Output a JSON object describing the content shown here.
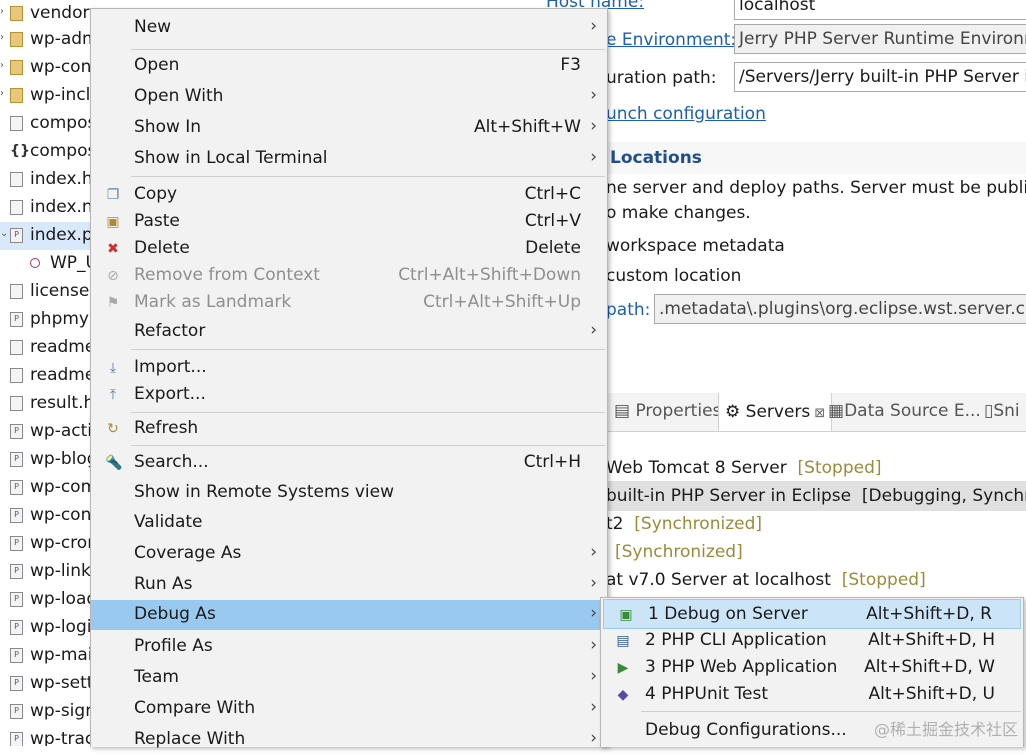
{
  "explorer": {
    "items": [
      {
        "name": "vendor",
        "icon": "folder-icon"
      },
      {
        "name": "wp-adm",
        "icon": "folder-icon"
      },
      {
        "name": "wp-con",
        "icon": "folder-icon"
      },
      {
        "name": "wp-inclu",
        "icon": "folder-icon"
      },
      {
        "name": "compos",
        "icon": "file-icon"
      },
      {
        "name": "compos",
        "icon": "json-file-icon"
      },
      {
        "name": "index.ht",
        "icon": "file-icon"
      },
      {
        "name": "index.ng",
        "icon": "file-icon"
      },
      {
        "name": "index.ph",
        "icon": "php-file-icon"
      },
      {
        "name": "WP_U",
        "icon": "class-icon"
      },
      {
        "name": "license.t",
        "icon": "file-icon"
      },
      {
        "name": "phpmya",
        "icon": "php-file-icon"
      },
      {
        "name": "readme",
        "icon": "file-icon"
      },
      {
        "name": "readme",
        "icon": "file-icon"
      },
      {
        "name": "result.ht",
        "icon": "file-icon"
      },
      {
        "name": "wp-acti",
        "icon": "php-file-icon"
      },
      {
        "name": "wp-blog",
        "icon": "php-file-icon"
      },
      {
        "name": "wp-com",
        "icon": "php-file-icon"
      },
      {
        "name": "wp-con",
        "icon": "php-file-icon"
      },
      {
        "name": "wp-cron",
        "icon": "php-file-icon"
      },
      {
        "name": "wp-link",
        "icon": "php-file-icon"
      },
      {
        "name": "wp-load",
        "icon": "php-file-icon"
      },
      {
        "name": "wp-logi",
        "icon": "php-file-icon"
      },
      {
        "name": "wp-mail",
        "icon": "php-file-icon"
      },
      {
        "name": "wp-sett",
        "icon": "php-file-icon"
      },
      {
        "name": "wp-sign",
        "icon": "php-file-icon"
      },
      {
        "name": "wp-trac",
        "icon": "php-file-icon"
      }
    ]
  },
  "editor": {
    "host_label": "Host name:",
    "host_value": "localhost",
    "runtime_label": "e Environment:",
    "runtime_value": "Jerry PHP Server Runtime Environme",
    "config_label": "uration path:",
    "config_value": "/Servers/Jerry built-in PHP Server in E",
    "launch_link": "unch configuration",
    "locations_heading": "Locations",
    "locations_desc1": "ne server and deploy paths. Server must be published",
    "locations_desc2": "o make changes.",
    "opt_workspace": "workspace metadata",
    "opt_custom": "custom location",
    "path_label": "path:",
    "path_value": ".metadata\\.plugins\\org.eclipse.wst.server.core\\"
  },
  "views": {
    "tabs": [
      "Properties",
      "Servers",
      "Data Source E...",
      "Sni"
    ],
    "servers": [
      {
        "name": "Web Tomcat 8 Server",
        "status": "[Stopped]"
      },
      {
        "name": "built-in PHP Server in Eclipse",
        "status": "[Debugging, Synchroniz"
      },
      {
        "name": "t2",
        "status": "[Synchronized]"
      },
      {
        "name": "",
        "status": "[Synchronized]"
      },
      {
        "name": "at v7.0 Server at localhost",
        "status": "[Stopped]"
      }
    ]
  },
  "context_menu": {
    "items": [
      {
        "label": "New",
        "shortcut": "",
        "submenu": true
      },
      {
        "label": "Open",
        "shortcut": "F3"
      },
      {
        "label": "Open With",
        "shortcut": "",
        "submenu": true
      },
      {
        "label": "Show In",
        "shortcut": "Alt+Shift+W",
        "submenu": true
      },
      {
        "label": "Show in Local Terminal",
        "shortcut": "",
        "submenu": true
      },
      {
        "label": "Copy",
        "shortcut": "Ctrl+C",
        "icon": "copy-icon"
      },
      {
        "label": "Paste",
        "shortcut": "Ctrl+V",
        "icon": "paste-icon"
      },
      {
        "label": "Delete",
        "shortcut": "Delete",
        "icon": "delete-icon"
      },
      {
        "label": "Remove from Context",
        "shortcut": "Ctrl+Alt+Shift+Down",
        "disabled": true,
        "icon": "remove-context-icon"
      },
      {
        "label": "Mark as Landmark",
        "shortcut": "Ctrl+Alt+Shift+Up",
        "disabled": true,
        "icon": "landmark-icon"
      },
      {
        "label": "Refactor",
        "shortcut": "",
        "submenu": true
      },
      {
        "label": "Import...",
        "shortcut": "",
        "icon": "import-icon"
      },
      {
        "label": "Export...",
        "shortcut": "",
        "icon": "export-icon"
      },
      {
        "label": "Refresh",
        "shortcut": "",
        "icon": "refresh-icon"
      },
      {
        "label": "Search...",
        "shortcut": "Ctrl+H",
        "icon": "search-icon"
      },
      {
        "label": "Show in Remote Systems view",
        "shortcut": ""
      },
      {
        "label": "Validate",
        "shortcut": ""
      },
      {
        "label": "Coverage As",
        "shortcut": "",
        "submenu": true
      },
      {
        "label": "Run As",
        "shortcut": "",
        "submenu": true
      },
      {
        "label": "Debug As",
        "shortcut": "",
        "submenu": true,
        "highlighted": true
      },
      {
        "label": "Profile As",
        "shortcut": "",
        "submenu": true
      },
      {
        "label": "Team",
        "shortcut": "",
        "submenu": true
      },
      {
        "label": "Compare With",
        "shortcut": "",
        "submenu": true
      },
      {
        "label": "Replace With",
        "shortcut": "",
        "submenu": true
      }
    ]
  },
  "debug_submenu": {
    "items": [
      {
        "label": "1 Debug on Server",
        "shortcut": "Alt+Shift+D, R",
        "icon": "debug-server-icon"
      },
      {
        "label": "2 PHP CLI Application",
        "shortcut": "Alt+Shift+D, H",
        "icon": "php-cli-icon"
      },
      {
        "label": "3 PHP Web Application",
        "shortcut": "Alt+Shift+D, W",
        "icon": "php-web-icon"
      },
      {
        "label": "4 PHPUnit Test",
        "shortcut": "Alt+Shift+D, U",
        "icon": "phpunit-icon"
      },
      {
        "label": "Debug Configurations...",
        "shortcut": ""
      }
    ]
  },
  "watermark": "@稀土掘金技术社区",
  "colors": {
    "highlight": "#99c9ef",
    "menu_bg": "#f2f2f2",
    "link": "#1a5fb4",
    "status_gold": "#9c8a3a"
  }
}
